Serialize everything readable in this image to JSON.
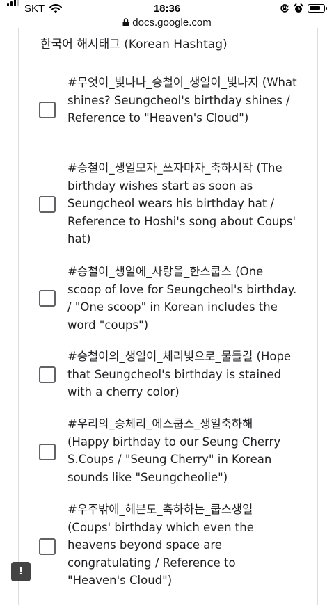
{
  "status_bar": {
    "carrier": "SKT",
    "time": "18:36"
  },
  "url_bar": {
    "domain": "docs.google.com"
  },
  "section": {
    "title": "한국어 해시태그 (Korean Hashtag)"
  },
  "options": [
    {
      "label": "#무엇이_빛나나_승철이_생일이_빛나지 (What shines? Seungcheol's birthday shines / Reference to \"Heaven's Cloud\")",
      "checked": false
    },
    {
      "label": "#승철이_생일모자_쓰자마자_축하시작 (The birthday wishes start as soon as Seungcheol wears his birthday hat / Reference to Hoshi's song about Coups' hat)",
      "checked": false
    },
    {
      "label": "#승철이_생일에_사랑을_한스쿱스 (One scoop of love for Seungcheol's birthday. / \"One scoop\" in Korean includes the word \"coups\")",
      "checked": false
    },
    {
      "label": "#승철이의_생일이_체리빛으로_물들길 (Hope that Seungcheol's birthday is stained with a cherry color)",
      "checked": false
    },
    {
      "label": "#우리의_승체리_에스쿱스_생일축하해 (Happy birthday to our Seung Cherry S.Coups / \"Seung Cherry\" in Korean sounds like \"Seungcheolie\")",
      "checked": false
    },
    {
      "label": "#우주밖에_헤븐도_축하하는_쿱스생일 (Coups' birthday which even the heavens beyond space are congratulating / Reference to \"Heaven's Cloud\")",
      "checked": false
    }
  ],
  "feedback_button": {
    "label": "!"
  }
}
